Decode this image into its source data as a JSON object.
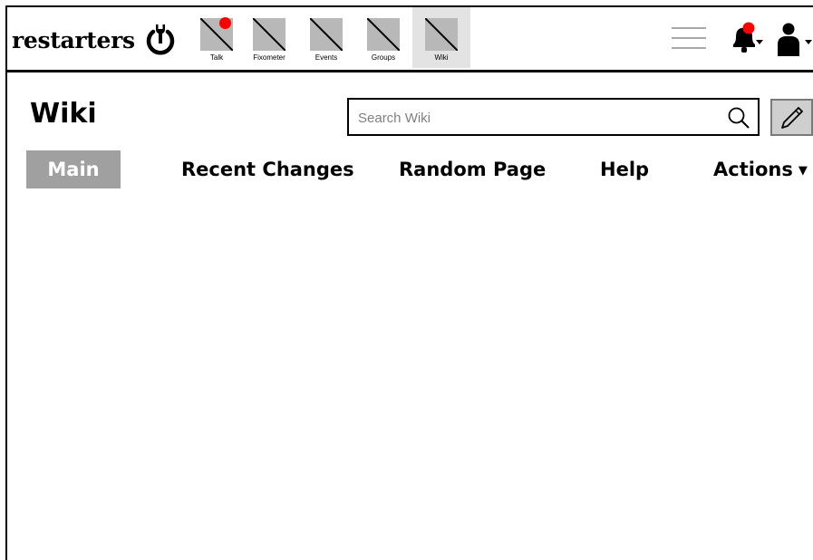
{
  "header": {
    "logo_text": "restarters",
    "nav_items": [
      {
        "label": "Talk",
        "badge_color": "#ff0000"
      },
      {
        "label": "Fixometer"
      },
      {
        "label": "Events"
      },
      {
        "label": "Groups"
      },
      {
        "label": "Wiki",
        "active": true
      }
    ],
    "notification_badge_color": "#ff0000"
  },
  "page": {
    "title": "Wiki",
    "search": {
      "placeholder": "Search Wiki",
      "value": ""
    },
    "tabs": [
      {
        "label": "Main",
        "active": true
      },
      {
        "label": "Recent Changes"
      },
      {
        "label": "Random Page"
      },
      {
        "label": "Help"
      },
      {
        "label": "Actions"
      }
    ]
  },
  "colors": {
    "active_tab_bg": "#a0a0a0",
    "active_nav_bg": "#e3e3e3",
    "badge": "#ff0000",
    "edit_button_bg": "#cfcfcf"
  },
  "icons": [
    "power-wrench-icon",
    "placeholder-image-icon",
    "hamburger-menu-icon",
    "bell-icon",
    "user-icon",
    "caret-down-icon",
    "search-icon",
    "pencil-icon"
  ]
}
